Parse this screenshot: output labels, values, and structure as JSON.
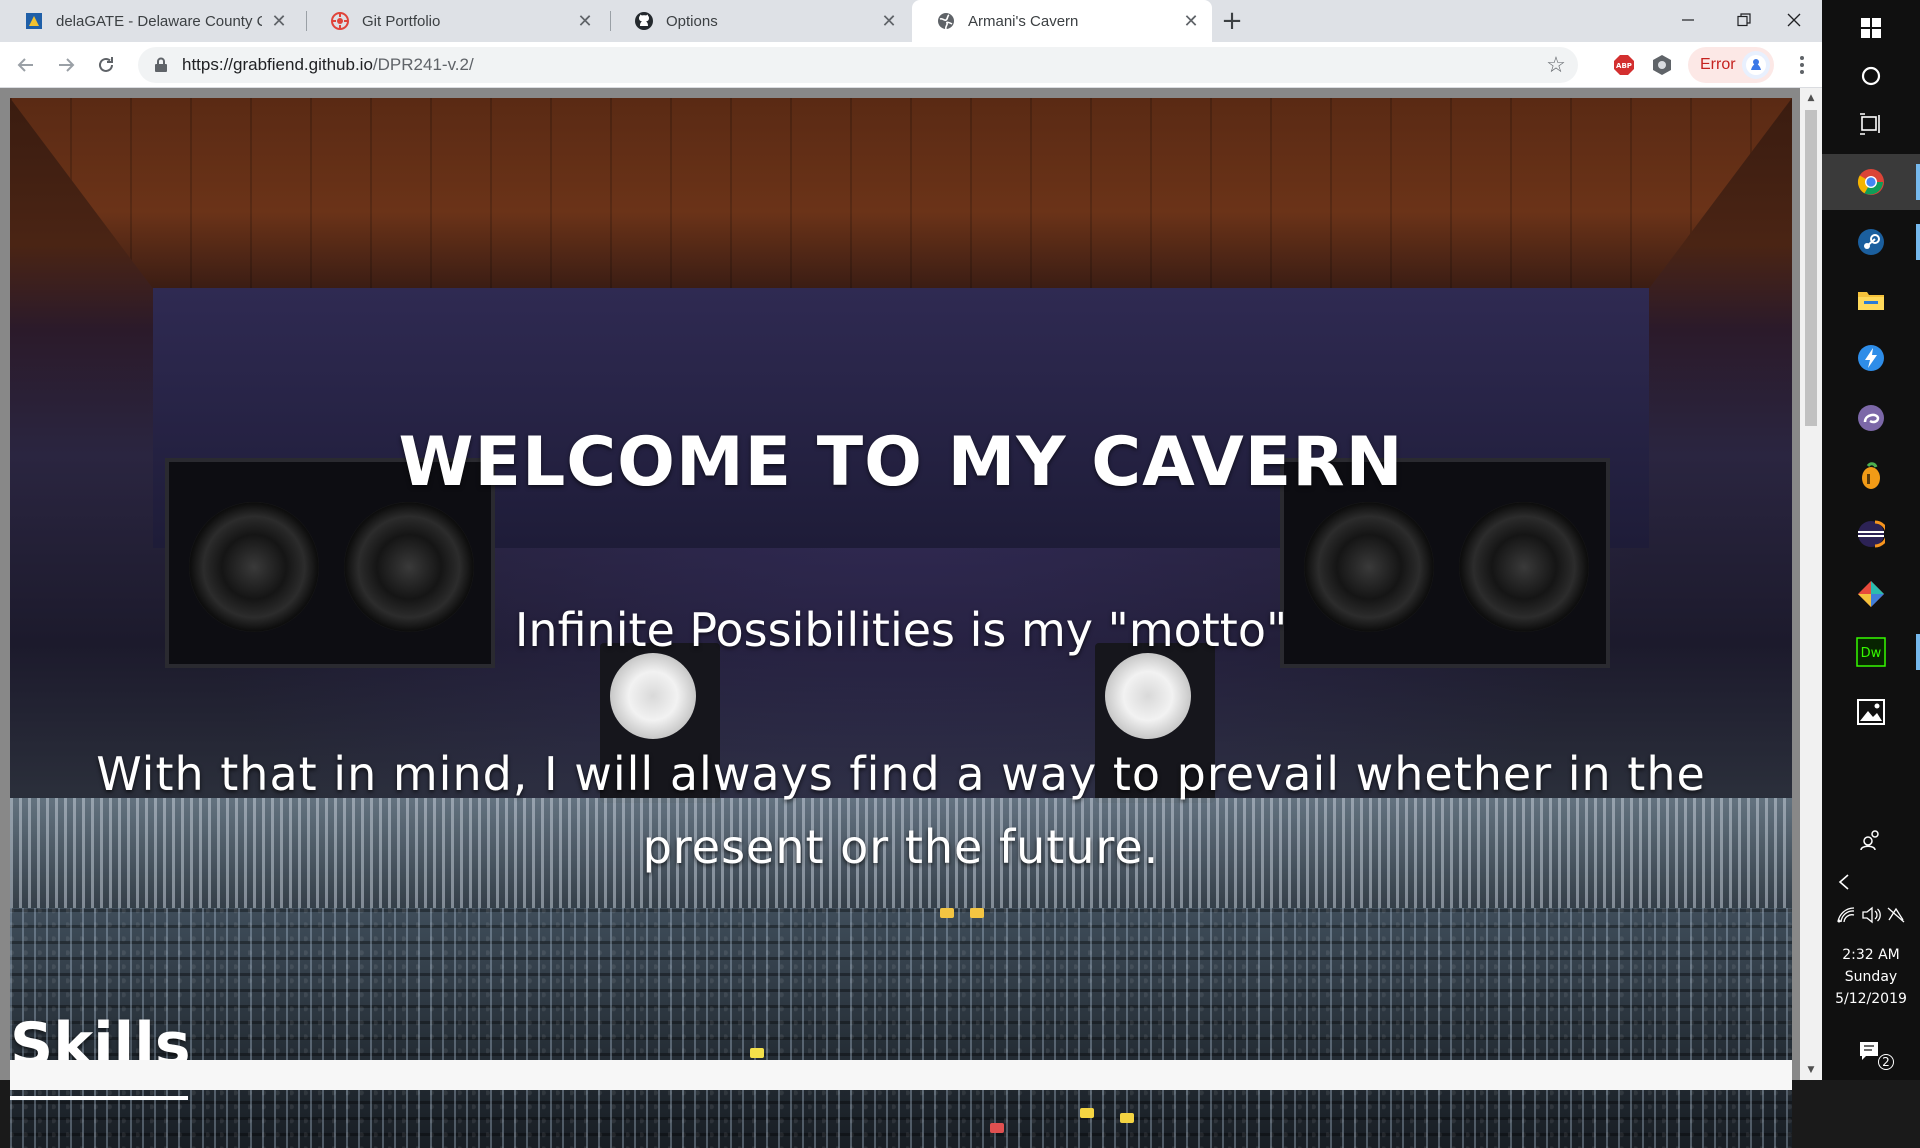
{
  "browser": {
    "tabs": [
      {
        "title": "delaGATE - Delaware County Com",
        "icon": "delagate-favicon",
        "active": false
      },
      {
        "title": "Git Portfolio",
        "icon": "git-portfolio-favicon",
        "active": false
      },
      {
        "title": "Options",
        "icon": "github-icon",
        "active": false
      },
      {
        "title": "Armani's Cavern",
        "icon": "globe-icon",
        "active": true
      }
    ],
    "new_tab_symbol": "+",
    "url_host": "https://grabfiend.github.io",
    "url_path": "/DPR241-v.2/",
    "error_label": "Error",
    "colors": {
      "accent": "#1a73e8",
      "error": "#c5221f"
    }
  },
  "page": {
    "hero_title": "WELCOME TO MY CAVERN",
    "motto": "Infinite Possibilities is my \"motto\"",
    "statement": "With that in mind, I will always find a way to prevail whether in the present or the future.",
    "skills_heading": "Skills"
  },
  "taskbar": {
    "icons": [
      "windows-start-icon",
      "cortana-icon",
      "task-view-icon",
      "chrome-icon",
      "steam-icon",
      "file-explorer-icon",
      "thunderbolt-app-icon",
      "bittorrent-icon",
      "fl-studio-icon",
      "eclipse-icon",
      "gitkraken-icon",
      "dreamweaver-icon",
      "photos-icon"
    ],
    "dreamweaver_label": "Dw",
    "time": "2:32 AM",
    "day": "Sunday",
    "date": "5/12/2019",
    "notification_count": "2"
  }
}
